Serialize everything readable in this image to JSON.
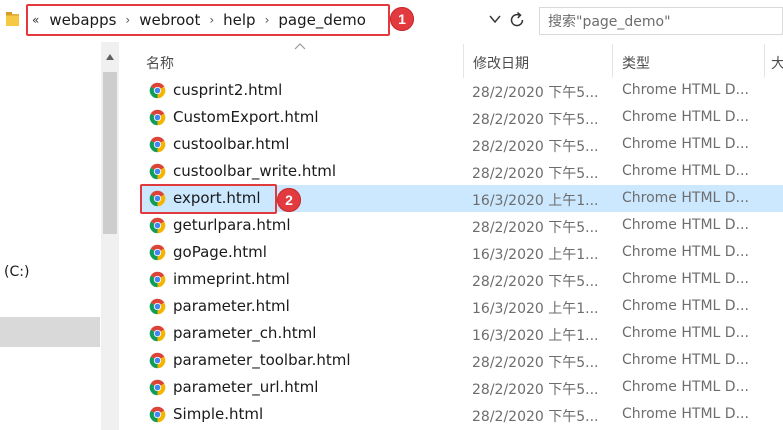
{
  "address_bar": {
    "overflow_glyph": "«",
    "breadcrumbs": [
      "webapps",
      "webroot",
      "help",
      "page_demo"
    ],
    "separator": "›"
  },
  "badges": {
    "first": "1",
    "second": "2"
  },
  "search": {
    "placeholder": "搜索\"page_demo\""
  },
  "nav": {
    "drive_label": "(C:)"
  },
  "columns": {
    "name": "名称",
    "date": "修改日期",
    "type": "类型",
    "size": "大"
  },
  "files": [
    {
      "name": "cusprint2.html",
      "date": "28/2/2020 下午5...",
      "type": "Chrome HTML D..."
    },
    {
      "name": "CustomExport.html",
      "date": "28/2/2020 下午5...",
      "type": "Chrome HTML D..."
    },
    {
      "name": "custoolbar.html",
      "date": "28/2/2020 下午5...",
      "type": "Chrome HTML D..."
    },
    {
      "name": "custoolbar_write.html",
      "date": "28/2/2020 下午5...",
      "type": "Chrome HTML D..."
    },
    {
      "name": "export.html",
      "date": "16/3/2020 上午1...",
      "type": "Chrome HTML D...",
      "selected": true
    },
    {
      "name": "geturlpara.html",
      "date": "28/2/2020 下午5...",
      "type": "Chrome HTML D..."
    },
    {
      "name": "goPage.html",
      "date": "16/3/2020 上午1...",
      "type": "Chrome HTML D..."
    },
    {
      "name": "immeprint.html",
      "date": "28/2/2020 下午5...",
      "type": "Chrome HTML D..."
    },
    {
      "name": "parameter.html",
      "date": "16/3/2020 上午1...",
      "type": "Chrome HTML D..."
    },
    {
      "name": "parameter_ch.html",
      "date": "16/3/2020 上午1...",
      "type": "Chrome HTML D..."
    },
    {
      "name": "parameter_toolbar.html",
      "date": "28/2/2020 下午5...",
      "type": "Chrome HTML D..."
    },
    {
      "name": "parameter_url.html",
      "date": "28/2/2020 下午5...",
      "type": "Chrome HTML D..."
    },
    {
      "name": "Simple.html",
      "date": "28/2/2020 下午5...",
      "type": "Chrome HTML D..."
    }
  ],
  "colors": {
    "highlight_red": "#e0393e",
    "selected_row": "#cce8ff",
    "chrome_red": "#db4437",
    "chrome_yellow": "#f4b400",
    "chrome_green": "#0f9d58",
    "chrome_blue": "#4285f4"
  },
  "icons": {
    "folder": "folder-icon",
    "file": "chrome-html-file-icon",
    "refresh": "refresh-icon",
    "dropdown": "chevron-down-icon",
    "sort": "sort-ascending-icon",
    "scroll_up": "scroll-up-arrow-icon"
  }
}
